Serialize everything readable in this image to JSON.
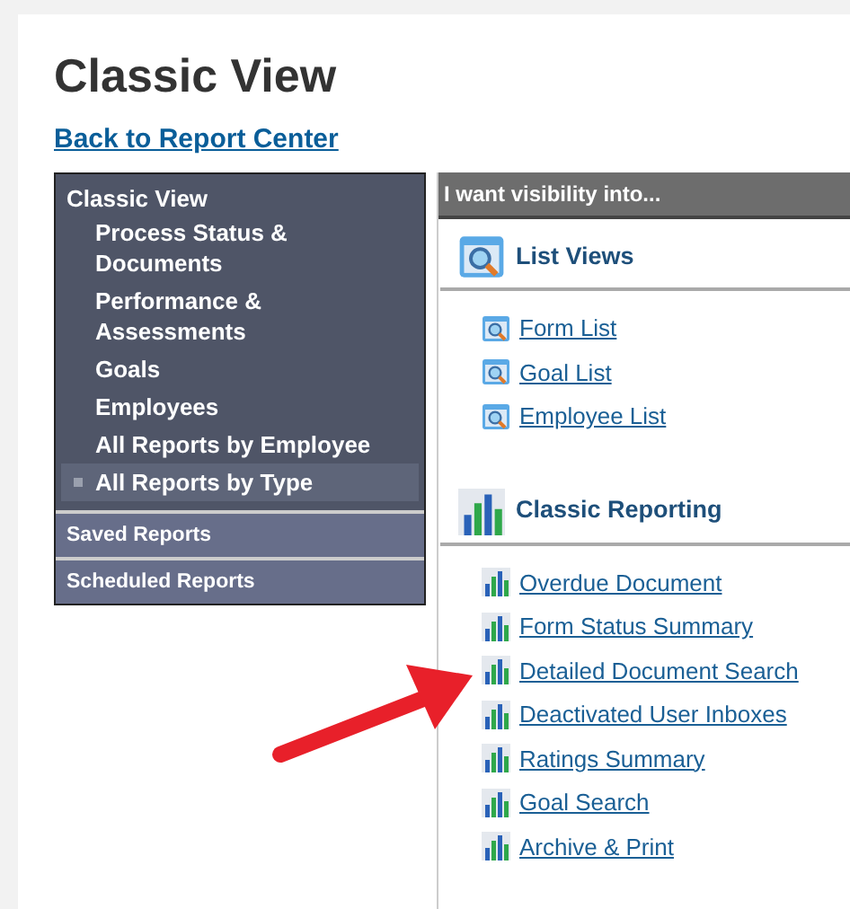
{
  "page": {
    "title": "Classic View",
    "back_link": "Back to Report Center"
  },
  "sidebar": {
    "header": "Classic View",
    "items": [
      {
        "label": "Process Status & Documents",
        "selected": false
      },
      {
        "label": "Performance & Assessments",
        "selected": false
      },
      {
        "label": "Goals",
        "selected": false
      },
      {
        "label": "Employees",
        "selected": false
      },
      {
        "label": "All Reports by Employee",
        "selected": false
      },
      {
        "label": "All Reports by Type",
        "selected": true
      }
    ],
    "sections": [
      "Saved Reports",
      "Scheduled Reports"
    ]
  },
  "panel": {
    "header": "I want visibility into...",
    "groups": [
      {
        "title": "List Views",
        "kind": "list",
        "links": [
          "Form List",
          "Goal List",
          "Employee List"
        ]
      },
      {
        "title": "Classic Reporting",
        "kind": "report",
        "links": [
          "Overdue Document",
          "Form Status Summary",
          "Detailed Document Search",
          "Deactivated User Inboxes",
          "Ratings Summary",
          "Goal Search",
          "Archive & Print"
        ]
      }
    ]
  }
}
